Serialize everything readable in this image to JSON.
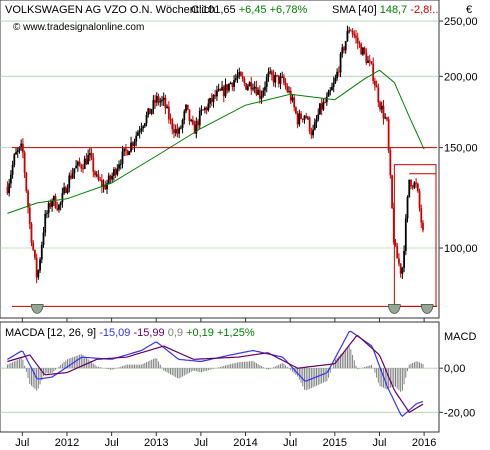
{
  "chart_data": [
    {
      "type": "candlestick",
      "title": "VOLKSWAGEN AG VZO O.N. Wöchentlich",
      "quote": {
        "close_label": "C:101,65",
        "change_label": "+6,45",
        "change_pct_label": "+6,78%",
        "sma_label": "SMA [40]",
        "sma_value_label": "148,7",
        "sma_change_label": "-2,8!.."
      },
      "watermark": "© www.tradesignalonline.com",
      "currency_label": "€",
      "y_scale": "log",
      "y_ticks": [
        "250,00",
        "200,00",
        "150,00",
        "100,00"
      ],
      "y_tick_values": [
        250,
        200,
        150,
        100
      ],
      "ylim": [
        76,
        270
      ],
      "x_ticks": [
        "Jul",
        "2012",
        "Jul",
        "2013",
        "Jul",
        "2014",
        "Jul",
        "2015",
        "Jul",
        "2016"
      ],
      "x_tick_dates": [
        "2011-07",
        "2012-01",
        "2012-07",
        "2013-01",
        "2013-07",
        "2014-01",
        "2014-07",
        "2015-01",
        "2015-07",
        "2016-01"
      ],
      "price_path": [
        {
          "date": "2011-05",
          "close": 128
        },
        {
          "date": "2011-06",
          "close": 145
        },
        {
          "date": "2011-07",
          "close": 150
        },
        {
          "date": "2011-08",
          "close": 110
        },
        {
          "date": "2011-09",
          "close": 88
        },
        {
          "date": "2011-10",
          "close": 112
        },
        {
          "date": "2011-11",
          "close": 122
        },
        {
          "date": "2011-12",
          "close": 118
        },
        {
          "date": "2012-01",
          "close": 130
        },
        {
          "date": "2012-02",
          "close": 138
        },
        {
          "date": "2012-03",
          "close": 140
        },
        {
          "date": "2012-04",
          "close": 145
        },
        {
          "date": "2012-05",
          "close": 132
        },
        {
          "date": "2012-06",
          "close": 128
        },
        {
          "date": "2012-07",
          "close": 133
        },
        {
          "date": "2012-08",
          "close": 142
        },
        {
          "date": "2012-09",
          "close": 148
        },
        {
          "date": "2012-10",
          "close": 155
        },
        {
          "date": "2012-11",
          "close": 165
        },
        {
          "date": "2012-12",
          "close": 172
        },
        {
          "date": "2013-01",
          "close": 182
        },
        {
          "date": "2013-02",
          "close": 180
        },
        {
          "date": "2013-03",
          "close": 165
        },
        {
          "date": "2013-04",
          "close": 158
        },
        {
          "date": "2013-05",
          "close": 175
        },
        {
          "date": "2013-06",
          "close": 160
        },
        {
          "date": "2013-07",
          "close": 172
        },
        {
          "date": "2013-08",
          "close": 178
        },
        {
          "date": "2013-09",
          "close": 185
        },
        {
          "date": "2013-10",
          "close": 188
        },
        {
          "date": "2013-11",
          "close": 195
        },
        {
          "date": "2013-12",
          "close": 200
        },
        {
          "date": "2014-01",
          "close": 193
        },
        {
          "date": "2014-02",
          "close": 195
        },
        {
          "date": "2014-03",
          "close": 185
        },
        {
          "date": "2014-04",
          "close": 200
        },
        {
          "date": "2014-05",
          "close": 198
        },
        {
          "date": "2014-06",
          "close": 196
        },
        {
          "date": "2014-07",
          "close": 185
        },
        {
          "date": "2014-08",
          "close": 168
        },
        {
          "date": "2014-09",
          "close": 172
        },
        {
          "date": "2014-10",
          "close": 158
        },
        {
          "date": "2014-11",
          "close": 175
        },
        {
          "date": "2014-12",
          "close": 182
        },
        {
          "date": "2015-01",
          "close": 195
        },
        {
          "date": "2015-02",
          "close": 220
        },
        {
          "date": "2015-03",
          "close": 245
        },
        {
          "date": "2015-04",
          "close": 230
        },
        {
          "date": "2015-05",
          "close": 218
        },
        {
          "date": "2015-06",
          "close": 205
        },
        {
          "date": "2015-07",
          "close": 180
        },
        {
          "date": "2015-08",
          "close": 165
        },
        {
          "date": "2015-09",
          "close": 100
        },
        {
          "date": "2015-10",
          "close": 90
        },
        {
          "date": "2015-11",
          "close": 132
        },
        {
          "date": "2015-12",
          "close": 128
        },
        {
          "date": "2016-01",
          "close": 102
        }
      ],
      "sma_path": [
        {
          "date": "2011-05",
          "value": 115
        },
        {
          "date": "2011-09",
          "value": 120
        },
        {
          "date": "2012-01",
          "value": 122
        },
        {
          "date": "2012-07",
          "value": 130
        },
        {
          "date": "2013-01",
          "value": 145
        },
        {
          "date": "2013-07",
          "value": 162
        },
        {
          "date": "2014-01",
          "value": 178
        },
        {
          "date": "2014-07",
          "value": 186
        },
        {
          "date": "2015-01",
          "value": 182
        },
        {
          "date": "2015-05",
          "value": 198
        },
        {
          "date": "2015-07",
          "value": 205
        },
        {
          "date": "2015-09",
          "value": 195
        },
        {
          "date": "2015-11",
          "value": 170
        },
        {
          "date": "2016-01",
          "value": 149
        }
      ],
      "horizontal_levels": [
        150,
        79
      ]
    },
    {
      "type": "macd",
      "title": "MACDA",
      "params_label": "[12, 26, 9]",
      "macd_label": "-15,09",
      "signal_label": "-15,99",
      "hist_label": "0,9",
      "change_label": "+0,19",
      "change_pct_label": "+1,25%",
      "panel_label": "MACD",
      "y_ticks": [
        "0,00",
        "-20,00"
      ],
      "y_tick_values": [
        0,
        -20
      ],
      "ylim": [
        -28,
        20
      ],
      "macd_path": [
        {
          "date": "2011-05",
          "value": 4
        },
        {
          "date": "2011-07",
          "value": 8
        },
        {
          "date": "2011-09",
          "value": -5
        },
        {
          "date": "2011-11",
          "value": -4
        },
        {
          "date": "2012-03",
          "value": 5
        },
        {
          "date": "2012-07",
          "value": 4
        },
        {
          "date": "2012-11",
          "value": 8
        },
        {
          "date": "2013-01",
          "value": 12
        },
        {
          "date": "2013-04",
          "value": 4
        },
        {
          "date": "2013-07",
          "value": 3
        },
        {
          "date": "2013-11",
          "value": 6
        },
        {
          "date": "2014-02",
          "value": 8
        },
        {
          "date": "2014-06",
          "value": 5
        },
        {
          "date": "2014-09",
          "value": -6
        },
        {
          "date": "2014-12",
          "value": -2
        },
        {
          "date": "2015-03",
          "value": 17
        },
        {
          "date": "2015-06",
          "value": 10
        },
        {
          "date": "2015-08",
          "value": -8
        },
        {
          "date": "2015-10",
          "value": -22
        },
        {
          "date": "2015-12",
          "value": -16
        },
        {
          "date": "2016-01",
          "value": -15
        }
      ],
      "signal_path": [
        {
          "date": "2011-05",
          "value": 3
        },
        {
          "date": "2011-08",
          "value": 6
        },
        {
          "date": "2011-10",
          "value": -3
        },
        {
          "date": "2012-01",
          "value": -2
        },
        {
          "date": "2012-05",
          "value": 4
        },
        {
          "date": "2012-09",
          "value": 5
        },
        {
          "date": "2013-02",
          "value": 10
        },
        {
          "date": "2013-06",
          "value": 4
        },
        {
          "date": "2013-12",
          "value": 5
        },
        {
          "date": "2014-04",
          "value": 7
        },
        {
          "date": "2014-08",
          "value": 0
        },
        {
          "date": "2015-01",
          "value": 2
        },
        {
          "date": "2015-04",
          "value": 15
        },
        {
          "date": "2015-07",
          "value": 6
        },
        {
          "date": "2015-09",
          "value": -10
        },
        {
          "date": "2015-11",
          "value": -20
        },
        {
          "date": "2016-01",
          "value": -16
        }
      ]
    }
  ],
  "colors": {
    "up": "#000000",
    "down": "#cc0000",
    "sma": "#008000",
    "level": "#cc0000",
    "macd": "#3333ff",
    "signal": "#660066",
    "hist": "#808080",
    "grid": "#b0d0b0",
    "marker_fill": "#8faa8f"
  }
}
